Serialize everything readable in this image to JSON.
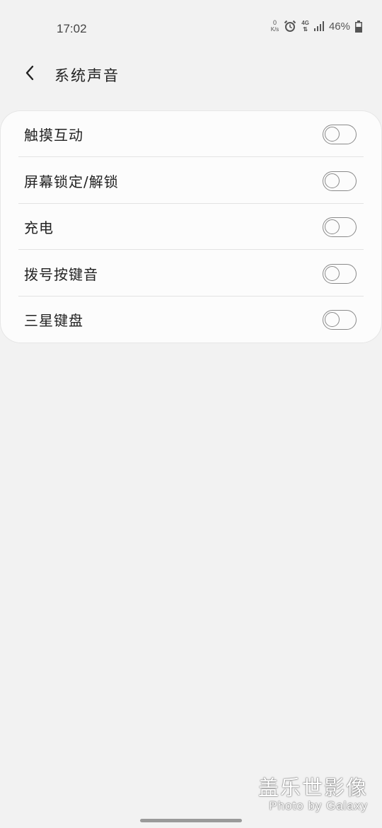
{
  "status_bar": {
    "time": "17:02",
    "net_speed_value": "0",
    "net_speed_unit": "K/s",
    "network_type": "4G",
    "battery_percent": "46%",
    "icons": [
      "alarm-icon",
      "signal-icon",
      "battery-icon"
    ]
  },
  "header": {
    "title": "系统声音",
    "back_icon": "chevron-left-icon"
  },
  "settings": [
    {
      "label": "触摸互动",
      "enabled": false
    },
    {
      "label": "屏幕锁定/解锁",
      "enabled": false
    },
    {
      "label": "充电",
      "enabled": false
    },
    {
      "label": "拨号按键音",
      "enabled": false
    },
    {
      "label": "三星键盘",
      "enabled": false
    }
  ],
  "watermark": {
    "title": "盖乐世影像",
    "subtitle": "Photo by Galaxy"
  },
  "colors": {
    "background": "#f2f2f2",
    "card": "#fcfcfc",
    "toggle_off": "#8a8a8a"
  }
}
